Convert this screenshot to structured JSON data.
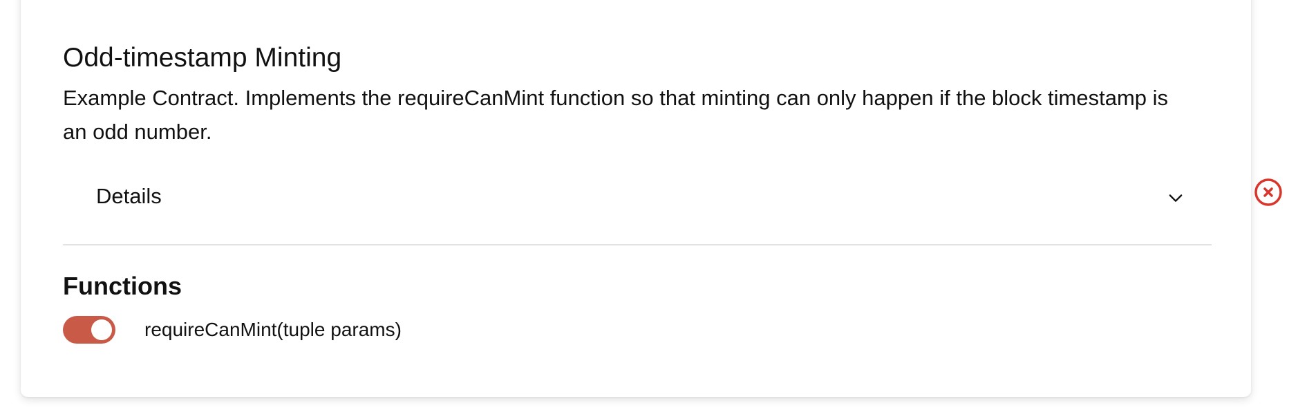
{
  "contract": {
    "title": "Odd-timestamp Minting",
    "description": "Example Contract. Implements the requireCanMint function so that minting can only happen if the block timestamp is an odd number."
  },
  "details": {
    "label": "Details",
    "icon": "chevron-down-icon",
    "expanded": false
  },
  "functions": {
    "heading": "Functions",
    "items": [
      {
        "label": "requireCanMint(tuple params)",
        "enabled": true
      }
    ]
  },
  "remove_button": {
    "icon": "close-circle-icon"
  },
  "colors": {
    "toggle_on": "#c95a48",
    "remove_icon": "#d9352b",
    "divider": "#e2e2e2"
  }
}
